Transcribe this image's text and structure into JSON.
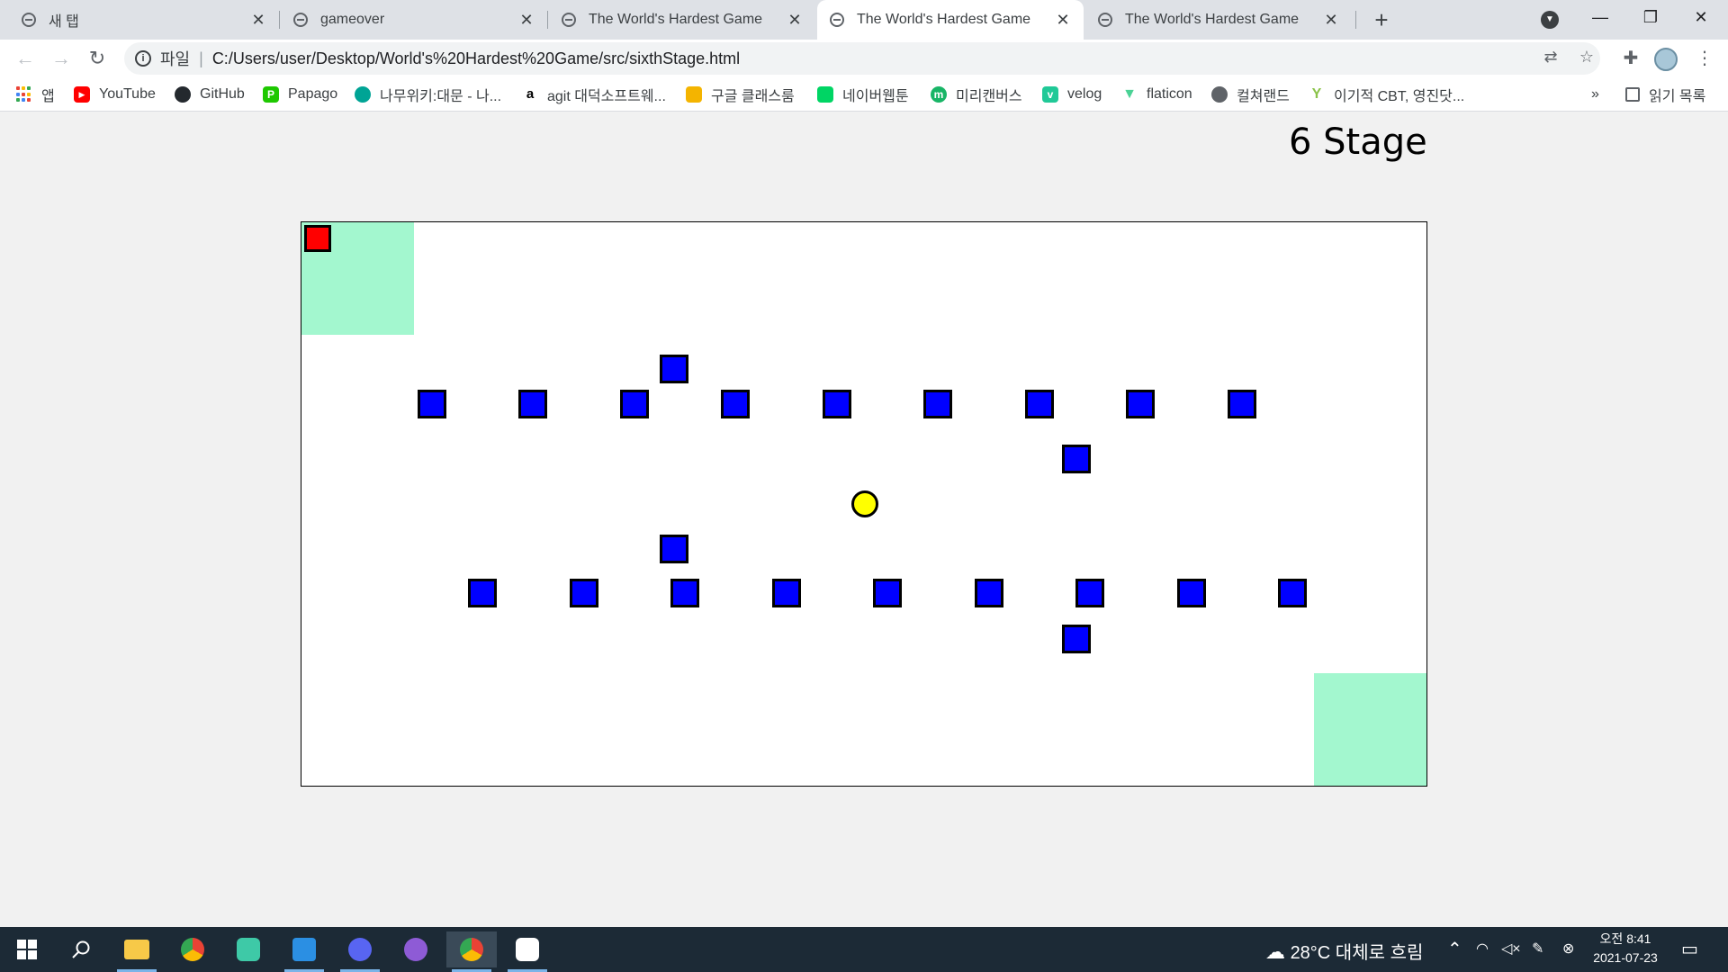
{
  "browser": {
    "tabs": [
      {
        "title": "새 탭",
        "close": "✕"
      },
      {
        "title": "gameover",
        "close": "✕"
      },
      {
        "title": "The World's Hardest Game",
        "close": "✕"
      },
      {
        "title": "The World's Hardest Game",
        "close": "✕"
      },
      {
        "title": "The World's Hardest Game",
        "close": "✕"
      }
    ],
    "active_tab_index": 3,
    "new_tab": "+",
    "window_controls": {
      "minimize": "—",
      "restore": "❐",
      "close": "✕"
    },
    "omnibox": {
      "scheme_label": "파일",
      "separator": "|",
      "url": "C:/Users/user/Desktop/World's%20Hardest%20Game/src/sixthStage.html"
    },
    "bookmarks": [
      {
        "label": "앱",
        "icon": "apps-grid-icon"
      },
      {
        "label": "YouTube",
        "icon": "youtube-icon",
        "color": "#ff0000"
      },
      {
        "label": "GitHub",
        "icon": "github-icon",
        "color": "#24292e"
      },
      {
        "label": "Papago",
        "icon": "papago-icon",
        "color": "#1ec800"
      },
      {
        "label": "나무위키:대문 - 나...",
        "icon": "namuwiki-icon",
        "color": "#00a495"
      },
      {
        "label": "agit 대덕소프트웨...",
        "icon": "agit-icon",
        "color": "#000000"
      },
      {
        "label": "구글 클래스룸",
        "icon": "classroom-icon",
        "color": "#f4b400"
      },
      {
        "label": "네이버웹툰",
        "icon": "naver-webtoon-icon",
        "color": "#00d564"
      },
      {
        "label": "미리캔버스",
        "icon": "miricanvas-icon",
        "color": "#18b566"
      },
      {
        "label": "velog",
        "icon": "velog-icon",
        "color": "#20c997"
      },
      {
        "label": "flaticon",
        "icon": "flaticon-icon",
        "color": "#4ad295"
      },
      {
        "label": "컬쳐랜드",
        "icon": "cultureland-icon",
        "color": "#5f6368"
      },
      {
        "label": "이기적 CBT, 영진닷...",
        "icon": "yj-icon",
        "color": "#8bc34a"
      }
    ],
    "bookmarks_overflow": "»",
    "reading_list": "읽기 목록"
  },
  "game": {
    "stage_title": "6 Stage",
    "colors": {
      "safe_zone": "#a3f7cf",
      "player": "#ff0000",
      "enemy": "#0000ff",
      "coin": "#ffff00"
    },
    "enemy_count": 22,
    "coin_count": 1
  },
  "taskbar": {
    "weather": "28°C 대체로 흐림",
    "time": "오전 8:41",
    "date": "2021-07-23",
    "apps": [
      "start-icon",
      "search-icon",
      "file-explorer-icon",
      "chrome-icon",
      "copilot-icon",
      "vscode-icon",
      "discord-icon",
      "github-desktop-icon",
      "chrome-icon",
      "chrome-profile-icon"
    ]
  }
}
